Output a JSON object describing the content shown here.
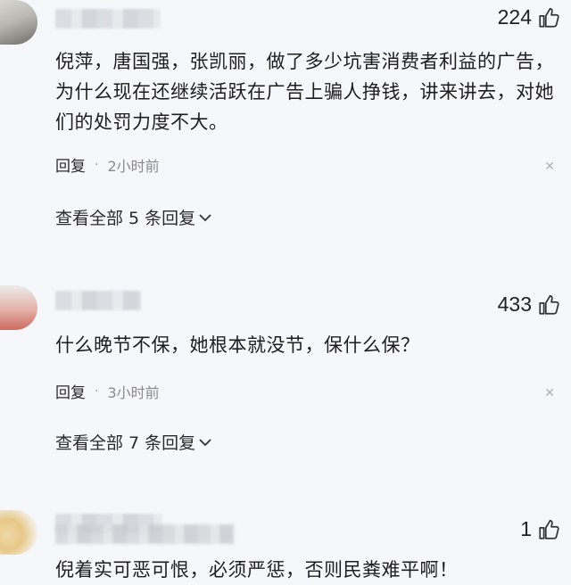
{
  "comments": [
    {
      "likes": "224",
      "text": "倪萍，唐国强，张凯丽，做了多少坑害消费者利益的广告，为什么现在还继续活跃在广告上骗人挣钱，讲来讲去，对她们的处罚力度不大。",
      "reply_label": "回复",
      "separator": "·",
      "time": "2小时前",
      "view_replies": "查看全部 5 条回复"
    },
    {
      "likes": "433",
      "text": "什么晚节不保，她根本就没节，保什么保？",
      "reply_label": "回复",
      "separator": "·",
      "time": "3小时前",
      "view_replies": "查看全部 7 条回复"
    },
    {
      "likes": "1",
      "text": "倪着实可恶可恨，必须严惩，否则民粪难平啊！"
    }
  ],
  "icons": {
    "like": "thumbs-up-icon",
    "close": "close-icon",
    "expand": "chevron-down-icon"
  }
}
